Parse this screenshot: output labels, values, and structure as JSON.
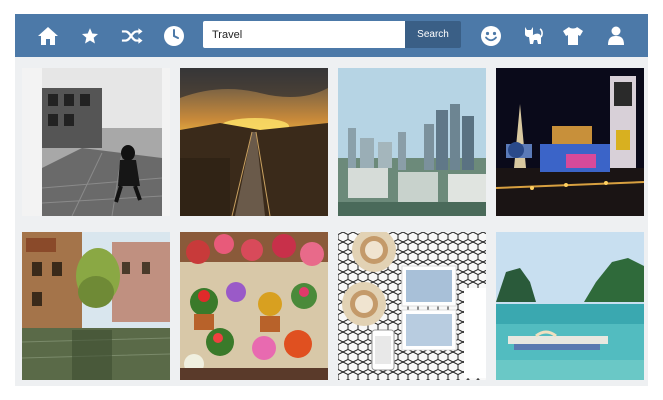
{
  "nav": {
    "left_icons": [
      "home-icon",
      "star-icon",
      "shuffle-icon",
      "clock-icon"
    ],
    "right_icons": [
      "smiley-icon",
      "cat-icon",
      "shirt-icon",
      "person-icon"
    ],
    "icon_color": "#ffffff",
    "bar_color": "#4c79a8"
  },
  "search": {
    "value": "Travel",
    "button_label": "Search",
    "button_color": "#3a5f86"
  },
  "gallery": {
    "photos": [
      "bw-street-photo",
      "sunset-road-photo",
      "city-skyline-photo",
      "las-vegas-night-photo",
      "canal-town-photo",
      "flower-pots-photo",
      "coffee-cups-photo",
      "tropical-beach-photo"
    ]
  }
}
